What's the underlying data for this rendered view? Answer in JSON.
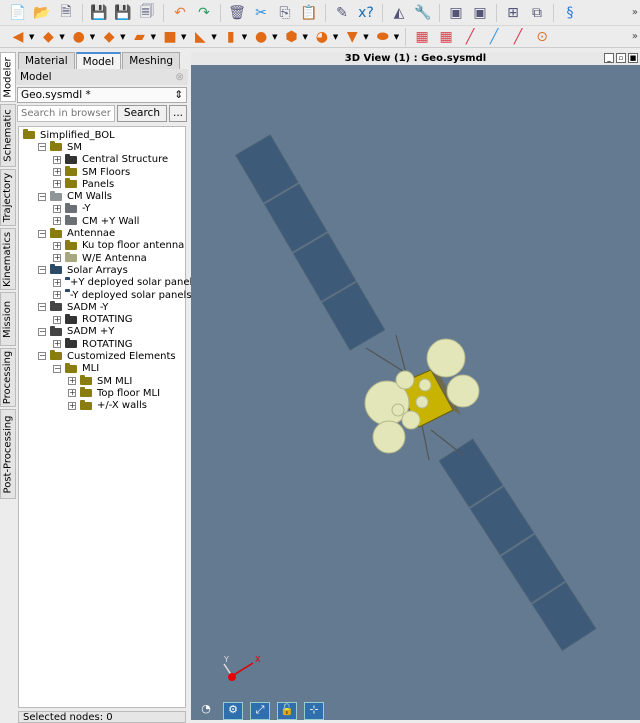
{
  "toolbar1": {
    "icons": [
      "new-file-icon",
      "open-folder-icon",
      "close-file-icon",
      "save-icon",
      "save-as-icon",
      "save-all-icon",
      "undo-icon",
      "redo-icon",
      "delete-icon",
      "cut-icon",
      "copy-icon",
      "paste-icon",
      "edit-icon",
      "replace-icon",
      "cone-tool-icon",
      "tool-wrench-icon",
      "add-chart-icon",
      "add-plot-icon",
      "layout-grid-icon",
      "window-arrange-icon",
      "export-icon"
    ],
    "more": "»"
  },
  "toolbar2": {
    "icons": [
      "triangle-shape-icon",
      "square-shape-icon",
      "disc-shape-icon",
      "quad-shape-icon",
      "plane-shape-icon",
      "box-shape-icon",
      "cone-shape-icon",
      "cylinder-shape-icon",
      "sphere-shape-icon",
      "polyhedron-shape-icon",
      "paraboloid-shape-icon",
      "cup-shape-icon",
      "ellipsoid-shape-icon",
      "mesh-grid-icon",
      "mesh-grid-normal-icon",
      "line-icon",
      "double-line-icon",
      "segment-icon",
      "point-icon"
    ],
    "more": "»"
  },
  "vertical_tabs": [
    "Modeler",
    "Schematic",
    "Trajectory",
    "Kinematics",
    "Mission",
    "Processing",
    "Post-Processing"
  ],
  "panel": {
    "tabs": [
      "Material",
      "Model",
      "Meshing"
    ],
    "header": "Model",
    "file_select": "Geo.sysmdl *",
    "search_placeholder": "Search in browser",
    "search_button": "Search",
    "more_button": "...",
    "tree": [
      {
        "label": "Simplified_BOL",
        "depth": 0,
        "color": "#8a7d10",
        "toggle": ""
      },
      {
        "label": "SM",
        "depth": 1,
        "color": "#8a7d10",
        "toggle": "−"
      },
      {
        "label": "Central Structure",
        "depth": 2,
        "color": "#333333",
        "toggle": "+"
      },
      {
        "label": "SM Floors",
        "depth": 2,
        "color": "#8a7d10",
        "toggle": "+"
      },
      {
        "label": "Panels",
        "depth": 2,
        "color": "#8a7d10",
        "toggle": "+"
      },
      {
        "label": "CM Walls",
        "depth": 1,
        "color": "#909598",
        "toggle": "−"
      },
      {
        "label": "-Y",
        "depth": 2,
        "color": "#6b7074",
        "toggle": "+"
      },
      {
        "label": "CM +Y Wall",
        "depth": 2,
        "color": "#6b7074",
        "toggle": "+"
      },
      {
        "label": "Antennae",
        "depth": 1,
        "color": "#8a7d10",
        "toggle": "−"
      },
      {
        "label": "Ku top floor antenna",
        "depth": 2,
        "color": "#8a7d10",
        "toggle": "+"
      },
      {
        "label": "W/E Antenna",
        "depth": 2,
        "color": "#a8a880",
        "toggle": "+"
      },
      {
        "label": "Solar Arrays",
        "depth": 1,
        "color": "#2d4a66",
        "toggle": "−"
      },
      {
        "label": "+Y deployed solar panels",
        "depth": 2,
        "color": "#2d4a66",
        "toggle": "+"
      },
      {
        "label": "-Y deployed solar panels",
        "depth": 2,
        "color": "#2d4a66",
        "toggle": "+"
      },
      {
        "label": "SADM -Y",
        "depth": 1,
        "color": "#444444",
        "toggle": "−"
      },
      {
        "label": "ROTATING",
        "depth": 2,
        "color": "#333333",
        "toggle": "+"
      },
      {
        "label": "SADM +Y",
        "depth": 1,
        "color": "#444444",
        "toggle": "−"
      },
      {
        "label": "ROTATING",
        "depth": 2,
        "color": "#333333",
        "toggle": "+"
      },
      {
        "label": "Customized Elements",
        "depth": 1,
        "color": "#8a7d10",
        "toggle": "−"
      },
      {
        "label": "MLI",
        "depth": 2,
        "color": "#8a7d10",
        "toggle": "−"
      },
      {
        "label": "SM MLI",
        "depth": 3,
        "color": "#8a7d10",
        "toggle": "+"
      },
      {
        "label": "Top floor MLI",
        "depth": 3,
        "color": "#8a7d10",
        "toggle": "+"
      },
      {
        "label": "+/-X walls",
        "depth": 3,
        "color": "#8a7d10",
        "toggle": "+"
      }
    ],
    "status": "Selected nodes: 0"
  },
  "view": {
    "title": "3D View (1) : Geo.sysmdl",
    "axis_x": "X",
    "axis_y": "Y",
    "background": "#637a91",
    "bottom_icons": [
      "compass-icon",
      "settings-gears-icon",
      "fit-view-icon",
      "unlock-icon",
      "axes-icon"
    ]
  }
}
